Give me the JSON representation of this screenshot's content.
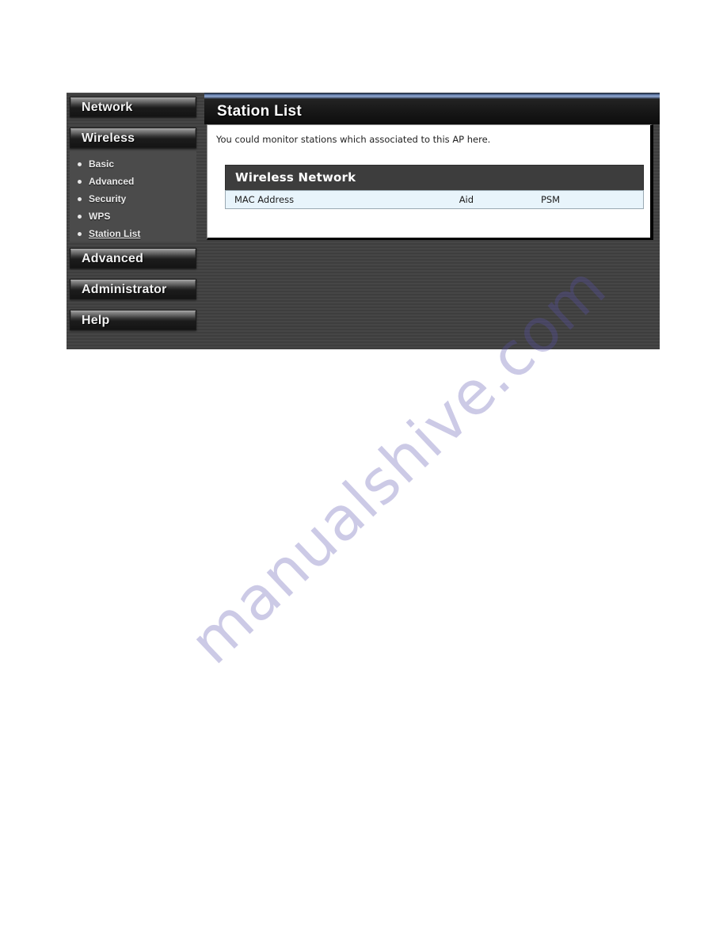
{
  "watermark": {
    "text": "manualshive.com",
    "color": "#5a52b0"
  },
  "sidebar": {
    "main_buttons": [
      {
        "id": "network",
        "label": "Network"
      },
      {
        "id": "wireless",
        "label": "Wireless"
      },
      {
        "id": "advanced",
        "label": "Advanced"
      },
      {
        "id": "administrator",
        "label": "Administrator"
      },
      {
        "id": "help",
        "label": "Help"
      }
    ],
    "submenu": {
      "parent": "Wireless",
      "items": [
        {
          "label": "Basic",
          "active": false
        },
        {
          "label": "Advanced",
          "active": false
        },
        {
          "label": "Security",
          "active": false
        },
        {
          "label": "WPS",
          "active": false
        },
        {
          "label": "Station List",
          "active": true
        }
      ]
    }
  },
  "content": {
    "page_title": "Station List",
    "intro_text": "You could monitor stations which associated to this AP here.",
    "card": {
      "title": "Wireless Network",
      "table": {
        "columns": [
          "MAC Address",
          "Aid",
          "PSM"
        ],
        "rows": []
      }
    }
  },
  "colors": {
    "panel_background": "#424242",
    "submenu_background": "#4b4b4b",
    "card_header": "#3d3d3d",
    "table_header_row": "#e8f4fb",
    "title_bar": "#161616",
    "accent_top_strip": "#93a9d0"
  }
}
